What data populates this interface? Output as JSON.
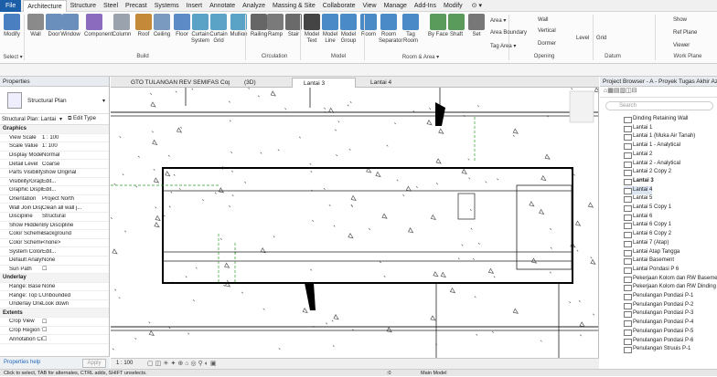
{
  "menu": [
    "Architecture",
    "Structure",
    "Steel",
    "Precast",
    "Systems",
    "Insert",
    "Annotate",
    "Analyze",
    "Massing & Site",
    "Collaborate",
    "View",
    "Manage",
    "Add-Ins",
    "Modify"
  ],
  "file_label": "File",
  "ribbon": {
    "buttons": [
      {
        "l": "Modify"
      },
      {
        "l": "Wall"
      },
      {
        "l": "Door"
      },
      {
        "l": "Window"
      },
      {
        "l": "Component"
      },
      {
        "l": "Column"
      },
      {
        "l": "Roof"
      },
      {
        "l": "Ceiling"
      },
      {
        "l": "Floor"
      },
      {
        "l": "Curtain System"
      },
      {
        "l": "Curtain Grid"
      },
      {
        "l": "Mullion"
      },
      {
        "l": "Railing"
      },
      {
        "l": "Ramp"
      },
      {
        "l": "Stair"
      },
      {
        "l": "Model Text"
      },
      {
        "l": "Model Line"
      },
      {
        "l": "Model Group"
      },
      {
        "l": "Room"
      },
      {
        "l": "Room Separator"
      },
      {
        "l": "Tag Room"
      },
      {
        "l": "By Face"
      },
      {
        "l": "Shaft"
      },
      {
        "l": "Set"
      }
    ],
    "groups": [
      "Select ▾",
      "Build",
      "Circulation",
      "Model",
      "Room & Area ▾",
      "Opening",
      "Datum",
      "Work Plane"
    ],
    "small": [
      "Area ▾",
      "Area Boundary",
      "Tag Area ▾",
      "Wall",
      "Vertical",
      "Dormer",
      "Level",
      "Grid",
      "Show",
      "Ref Plane",
      "Viewer"
    ]
  },
  "properties": {
    "title": "Properties",
    "type_name": "Structural Plan",
    "selector": "Structural Plan: Lantai",
    "edit_type": "Edit Type",
    "rows": [
      {
        "s": "Graphics"
      },
      {
        "k": "View Scale",
        "v": "1 : 100"
      },
      {
        "k": "Scale Value",
        "v": "1:  100"
      },
      {
        "k": "Display Model",
        "v": "Normal"
      },
      {
        "k": "Detail Level",
        "v": "Coarse"
      },
      {
        "k": "Parts Visibility",
        "v": "Show Original"
      },
      {
        "k": "Visibility/Grap...",
        "v": "Edit..."
      },
      {
        "k": "Graphic Displ...",
        "v": "Edit..."
      },
      {
        "k": "Orientation",
        "v": "Project North"
      },
      {
        "k": "Wall Join Disp...",
        "v": "Clean all wall j..."
      },
      {
        "k": "Discipline",
        "v": "Structural"
      },
      {
        "k": "Show Hidden ...",
        "v": "By Discipline"
      },
      {
        "k": "Color Scheme ...",
        "v": "Background"
      },
      {
        "k": "Color Scheme",
        "v": "<none>"
      },
      {
        "k": "System Color ...",
        "v": "Edit..."
      },
      {
        "k": "Default Analys...",
        "v": "None"
      },
      {
        "k": "Sun Path",
        "v": "☐"
      },
      {
        "s": "Underlay"
      },
      {
        "k": "Range: Base L...",
        "v": "None"
      },
      {
        "k": "Range: Top Le...",
        "v": "Unbounded"
      },
      {
        "k": "Underlay Orie...",
        "v": "Look down"
      },
      {
        "s": "Extents"
      },
      {
        "k": "Crop View",
        "v": "☐"
      },
      {
        "k": "Crop Region V...",
        "v": "☐"
      },
      {
        "k": "Annotation Cr...",
        "v": "☐"
      }
    ],
    "help": "Properties help",
    "apply": "Apply"
  },
  "tabs": [
    {
      "l": "GTO TULANGAN REV SEMIFAS Cop..."
    },
    {
      "l": "(3D)"
    },
    {
      "l": "Lantai 3"
    },
    {
      "l": "Lantai 4"
    }
  ],
  "viewbar_scale": "1 : 100",
  "browser": {
    "title": "Project Browser - A - Proyek Tugas Akhir Azka...",
    "search": "Search",
    "items": [
      "Dinding Retaining Wall",
      "Lantai 1",
      "Lantai 1 (Muka Air Tanah)",
      "Lantai 1 - Analytical",
      "Lantai 2",
      "Lantai 2 - Analytical",
      "Lantai 2 Copy 2",
      "Lantai 3",
      "Lantai 4",
      "Lantai 5",
      "Lantai 5 Copy 1",
      "Lantai 6",
      "Lantai 6 Copy 1",
      "Lantai 6 Copy 2",
      "Lantai 7 (Atap)",
      "Lantai Atap Tangga",
      "Lantai Basement",
      "Lantai Pondasi P 6",
      "Pekerjaan Kolom dan RW Basement",
      "Pekerjaan Kolom dan RW Dinding",
      "Penulangan Pondasi P-1",
      "Penulangan Pondasi P-2",
      "Penulangan Pondasi P-3",
      "Penulangan Pondasi P-4",
      "Penulangan Pondasi P-5",
      "Penulangan Pondasi P-6",
      "Penulangan Struuis P-1"
    ]
  },
  "status": {
    "hint": "Click to select, TAB for alternates, CTRL adds, SHIFT unselects.",
    "zero": ":0",
    "model": "Main Model"
  }
}
